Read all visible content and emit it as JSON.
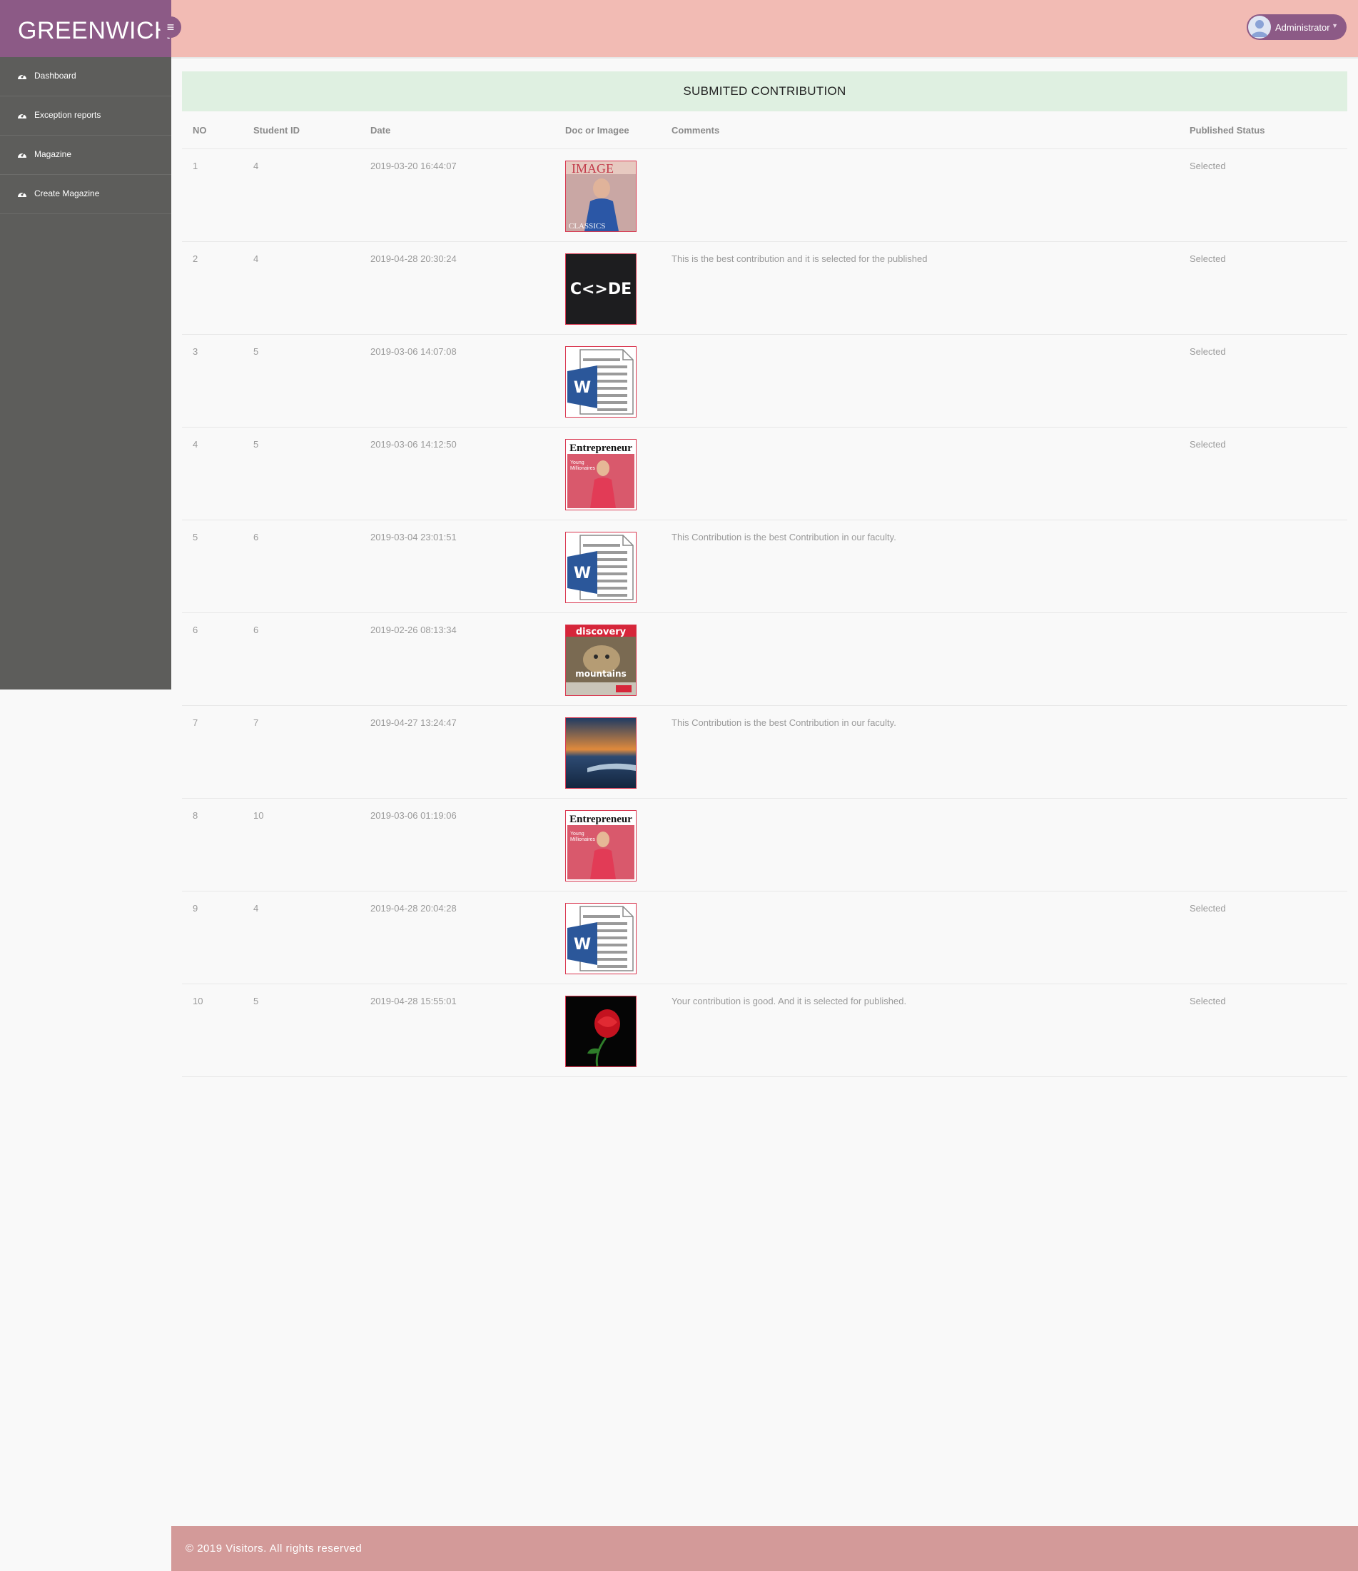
{
  "brand": "GREENWICH",
  "header": {
    "user_name": "Administrator"
  },
  "sidebar": {
    "items": [
      {
        "label": "Dashboard"
      },
      {
        "label": "Exception reports"
      },
      {
        "label": "Magazine"
      },
      {
        "label": "Create Magazine"
      }
    ]
  },
  "main": {
    "title": "SUBMITED CONTRIBUTION",
    "columns": [
      "NO",
      "Student ID",
      "Date",
      "Doc or Imagee",
      "Comments",
      "Published Status"
    ],
    "rows": [
      {
        "no": "1",
        "student_id": "4",
        "date": "2019-03-20 16:44:07",
        "thumb": "fashion-magazine-cover",
        "comment": "",
        "status": "Selected"
      },
      {
        "no": "2",
        "student_id": "4",
        "date": "2019-04-28 20:30:24",
        "thumb": "code-logo",
        "comment": "This is the best contribution and it is selected for the published",
        "status": "Selected"
      },
      {
        "no": "3",
        "student_id": "5",
        "date": "2019-03-06 14:07:08",
        "thumb": "word-doc",
        "comment": "",
        "status": "Selected"
      },
      {
        "no": "4",
        "student_id": "5",
        "date": "2019-03-06 14:12:50",
        "thumb": "entrepreneur-cover",
        "comment": "",
        "status": "Selected"
      },
      {
        "no": "5",
        "student_id": "6",
        "date": "2019-03-04 23:01:51",
        "thumb": "word-doc",
        "comment": "This Contribution is the best Contribution in our faculty.",
        "status": ""
      },
      {
        "no": "6",
        "student_id": "6",
        "date": "2019-02-26 08:13:34",
        "thumb": "discovery-cover",
        "comment": "",
        "status": ""
      },
      {
        "no": "7",
        "student_id": "7",
        "date": "2019-04-27 13:24:47",
        "thumb": "sunset-photo",
        "comment": "This Contribution is the best Contribution in our faculty.",
        "status": ""
      },
      {
        "no": "8",
        "student_id": "10",
        "date": "2019-03-06 01:19:06",
        "thumb": "entrepreneur-cover",
        "comment": "",
        "status": ""
      },
      {
        "no": "9",
        "student_id": "4",
        "date": "2019-04-28 20:04:28",
        "thumb": "word-doc",
        "comment": "",
        "status": "Selected"
      },
      {
        "no": "10",
        "student_id": "5",
        "date": "2019-04-28 15:55:01",
        "thumb": "rose-photo",
        "comment": "Your contribution is good. And it is selected for published.",
        "status": "Selected"
      }
    ]
  },
  "footer": "© 2019 Visitors. All rights reserved"
}
